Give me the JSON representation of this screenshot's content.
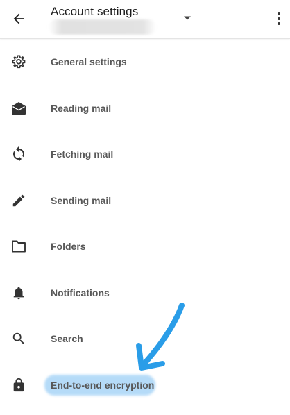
{
  "header": {
    "title": "Account settings"
  },
  "icons": {
    "back": "arrow-back-icon",
    "dropdown": "dropdown-arrow-icon",
    "more": "more-vert-icon"
  },
  "settings": {
    "items": [
      {
        "label": "General settings",
        "icon": "gear-icon"
      },
      {
        "label": "Reading mail",
        "icon": "envelope-open-icon"
      },
      {
        "label": "Fetching mail",
        "icon": "sync-icon"
      },
      {
        "label": "Sending mail",
        "icon": "pencil-icon"
      },
      {
        "label": "Folders",
        "icon": "folder-icon"
      },
      {
        "label": "Notifications",
        "icon": "bell-icon"
      },
      {
        "label": "Search",
        "icon": "search-icon"
      },
      {
        "label": "End-to-end encryption",
        "icon": "lock-icon"
      }
    ]
  },
  "annotation": {
    "highlight_color": "#a9d5f7",
    "arrow_color": "#2a9de8"
  }
}
